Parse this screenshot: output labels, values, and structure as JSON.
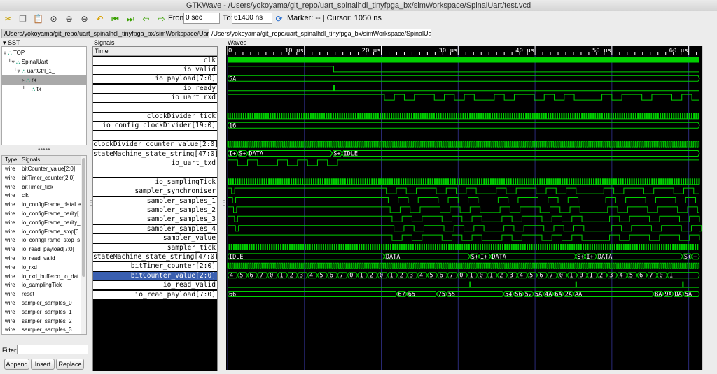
{
  "window": {
    "title": "GTKWave - /Users/yokoyama/git_repo/uart_spinalhdl_tinyfpga_bx/simWorkspace/SpinalUart/test.vcd"
  },
  "toolbar": {
    "from_label": "From:",
    "from_value": "0 sec",
    "to_label": "To:",
    "to_value": "61400 ns",
    "marker_text": "Marker: --  |  Cursor: 1050 ns",
    "icons": [
      "cut-icon",
      "copy-icon",
      "paste-icon",
      "zoom-fit-icon",
      "zoom-in-icon",
      "zoom-out-icon",
      "zoom-undo-icon",
      "zoom-start-icon",
      "zoom-end-icon",
      "prev-edge-icon",
      "next-edge-icon",
      "reload-icon"
    ]
  },
  "tabs": [
    {
      "label": "/Users/yokoyama/git_repo/uart_spinalhdl_tinyfpga_bx/simWorkspace/UartCtrl/test.vcd"
    },
    {
      "label": "/Users/yokoyama/git_repo/uart_spinalhdl_tinyfpga_bx/simWorkspace/SpinalUart/test.vcd"
    }
  ],
  "sst": {
    "label": "SST",
    "tree": [
      {
        "name": "TOP"
      },
      {
        "name": "SpinalUart"
      },
      {
        "name": "uartCtrl_1_"
      },
      {
        "name": "rx"
      },
      {
        "name": "tx"
      }
    ]
  },
  "signal_table": {
    "col_type": "Type",
    "col_signals": "Signals",
    "rows": [
      {
        "type": "wire",
        "name": "bitCounter_value[2:0]"
      },
      {
        "type": "wire",
        "name": "bitTimer_counter[2:0]"
      },
      {
        "type": "wire",
        "name": "bitTimer_tick"
      },
      {
        "type": "wire",
        "name": "clk"
      },
      {
        "type": "wire",
        "name": "io_configFrame_dataLe"
      },
      {
        "type": "wire",
        "name": "io_configFrame_parity["
      },
      {
        "type": "wire",
        "name": "io_configFrame_parity_"
      },
      {
        "type": "wire",
        "name": "io_configFrame_stop[0"
      },
      {
        "type": "wire",
        "name": "io_configFrame_stop_s"
      },
      {
        "type": "wire",
        "name": "io_read_payload[7:0]"
      },
      {
        "type": "wire",
        "name": "io_read_valid"
      },
      {
        "type": "wire",
        "name": "io_rxd"
      },
      {
        "type": "wire",
        "name": "io_rxd_bufferco_io_dat"
      },
      {
        "type": "wire",
        "name": "io_samplingTick"
      },
      {
        "type": "wire",
        "name": "reset"
      },
      {
        "type": "wire",
        "name": "sampler_samples_0"
      },
      {
        "type": "wire",
        "name": "sampler_samples_1"
      },
      {
        "type": "wire",
        "name": "sampler_samples_2"
      },
      {
        "type": "wire",
        "name": "sampler_samples_3"
      }
    ]
  },
  "filter": {
    "label": "Filter:",
    "value": ""
  },
  "buttons": {
    "append": "Append",
    "insert": "Insert",
    "replace": "Replace"
  },
  "signals_panel": {
    "label": "Signals",
    "time_header": "Time",
    "rows": [
      "clk",
      "io_valid",
      "io_payload[7:0]",
      "io_ready",
      "io_uart_rxd",
      "",
      "clockDivider_tick",
      "io_config_clockDivider[19:0]",
      "",
      "clockDivider_counter_value[2:0]",
      "stateMachine_state_string[47:0]",
      "io_uart_txd",
      "",
      "io_samplingTick",
      "sampler_synchroniser",
      "sampler_samples_1",
      "sampler_samples_2",
      "sampler_samples_3",
      "sampler_samples_4",
      "sampler_value",
      "sampler_tick",
      "stateMachine_state_string[47:0]",
      "bitTimer_counter[2:0]",
      "bitCounter_value[2:0]",
      "io_read_valid",
      "io_read_payload[7:0]"
    ],
    "selected_index": 23
  },
  "waves_panel": {
    "label": "Waves",
    "ticks": [
      "0",
      "10 us",
      "20 us",
      "30 us",
      "40 us",
      "50 us",
      "60 us"
    ],
    "tick_ns": [
      0,
      10000,
      20000,
      30000,
      40000,
      50000,
      60000
    ],
    "range_ns": [
      0,
      61400
    ],
    "labels": [
      {
        "row": 2,
        "t": 0,
        "text": "5A"
      },
      {
        "row": 7,
        "t": 0,
        "text": "16"
      },
      {
        "row": 10,
        "t": 0,
        "text": "I+"
      },
      {
        "row": 10,
        "t": 1300,
        "text": "S+"
      },
      {
        "row": 10,
        "t": 2600,
        "text": "DATA"
      },
      {
        "row": 10,
        "t": 13600,
        "text": "S+"
      },
      {
        "row": 10,
        "t": 14900,
        "text": "IDLE"
      },
      {
        "row": 21,
        "t": 0,
        "text": "IDLE"
      },
      {
        "row": 21,
        "t": 20400,
        "text": "DATA"
      },
      {
        "row": 21,
        "t": 31500,
        "text": "S+"
      },
      {
        "row": 21,
        "t": 32700,
        "text": "I+"
      },
      {
        "row": 21,
        "t": 34200,
        "text": "DATA"
      },
      {
        "row": 21,
        "t": 45300,
        "text": "S+"
      },
      {
        "row": 21,
        "t": 46500,
        "text": "I+"
      },
      {
        "row": 21,
        "t": 48000,
        "text": "DATA"
      },
      {
        "row": 21,
        "t": 59200,
        "text": "S+"
      },
      {
        "row": 21,
        "t": 60400,
        "text": "+"
      },
      {
        "row": 25,
        "t": 0,
        "text": "66"
      },
      {
        "row": 25,
        "t": 22000,
        "text": "67"
      },
      {
        "row": 25,
        "t": 23300,
        "text": "65"
      },
      {
        "row": 25,
        "t": 27200,
        "text": "75"
      },
      {
        "row": 25,
        "t": 28500,
        "text": "55"
      },
      {
        "row": 25,
        "t": 35900,
        "text": "54"
      },
      {
        "row": 25,
        "t": 37200,
        "text": "56"
      },
      {
        "row": 25,
        "t": 38500,
        "text": "52"
      },
      {
        "row": 25,
        "t": 39800,
        "text": "5A"
      },
      {
        "row": 25,
        "t": 41100,
        "text": "4A"
      },
      {
        "row": 25,
        "t": 42400,
        "text": "6A"
      },
      {
        "row": 25,
        "t": 43700,
        "text": "2A"
      },
      {
        "row": 25,
        "t": 45000,
        "text": "AA"
      },
      {
        "row": 25,
        "t": 55400,
        "text": "BA"
      },
      {
        "row": 25,
        "t": 56700,
        "text": "9A"
      },
      {
        "row": 25,
        "t": 58000,
        "text": "DA"
      },
      {
        "row": 25,
        "t": 59300,
        "text": "5A"
      }
    ],
    "bitcounter_digits": [
      "4",
      "5",
      "6",
      "7",
      "0",
      "1",
      "2",
      "3",
      "4",
      "5",
      "6",
      "7",
      "0",
      "1",
      "2",
      "0",
      "1",
      "2",
      "3",
      "4",
      "5",
      "6",
      "7",
      "0",
      "1",
      "0",
      "1",
      "2",
      "3",
      "4",
      "5",
      "6",
      "7",
      "0",
      "1",
      "0",
      "1",
      "2",
      "3",
      "4",
      "5",
      "6",
      "7",
      "0",
      "1"
    ]
  },
  "colors": {
    "wave": "#00d000",
    "grid": "#2a2a78",
    "selected": "#3a5fb0",
    "text": "#ffffff"
  }
}
